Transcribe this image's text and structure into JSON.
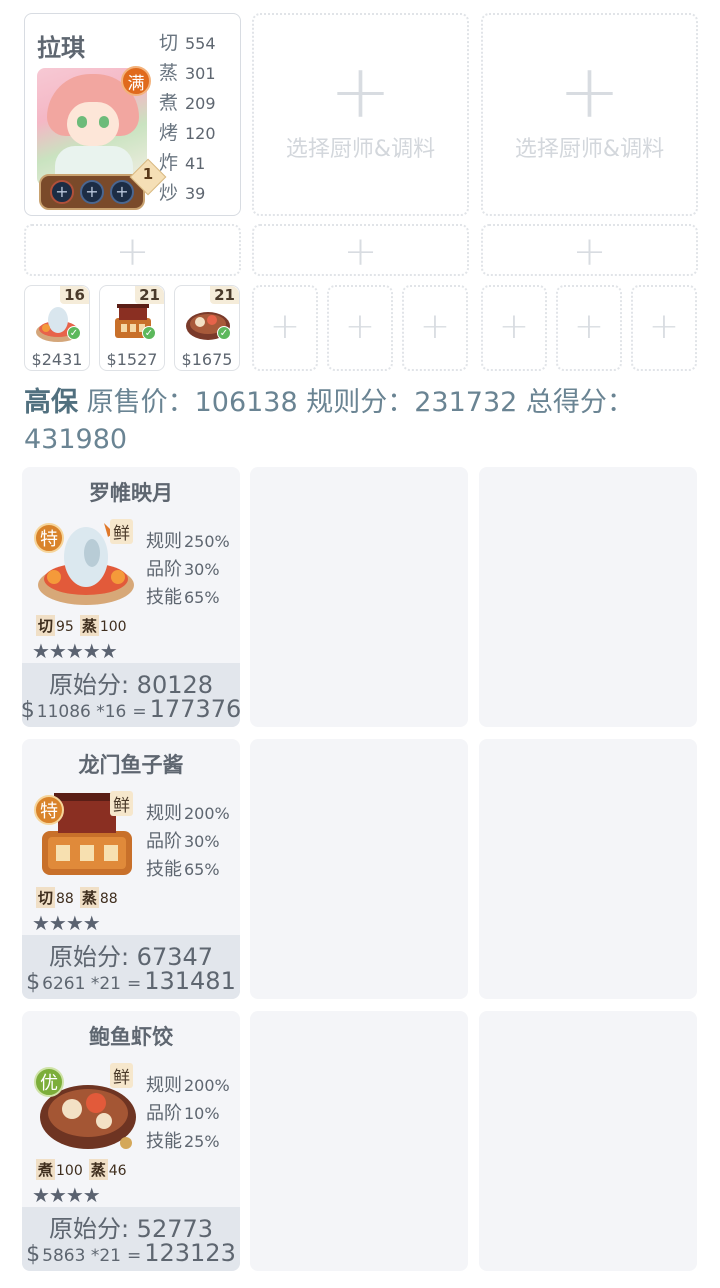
{
  "chef": {
    "name": "拉琪",
    "full_badge": "满",
    "level": "1",
    "skills": [
      {
        "name": "切",
        "value": "554"
      },
      {
        "name": "蒸",
        "value": "301"
      },
      {
        "name": "煮",
        "value": "209"
      },
      {
        "name": "烤",
        "value": "120"
      },
      {
        "name": "炸",
        "value": "41"
      },
      {
        "name": "炒",
        "value": "39"
      }
    ]
  },
  "chef_slots": [
    {
      "label": "选择厨师&调料"
    },
    {
      "label": "选择厨师&调料"
    }
  ],
  "recipe_cards": [
    {
      "count": "16",
      "price": "$2431"
    },
    {
      "count": "21",
      "price": "$1527"
    },
    {
      "count": "21",
      "price": "$1675"
    }
  ],
  "score": {
    "grade": "高保",
    "text": "原售价：106138 规则分：231732 总得分：431980"
  },
  "dishes": [
    {
      "title": "罗帷映月",
      "tier": "特",
      "tag": "鲜",
      "mods": [
        {
          "name": "规则",
          "value": "250%"
        },
        {
          "name": "品阶",
          "value": "30%"
        },
        {
          "name": "技能",
          "value": "65%"
        }
      ],
      "reqs": [
        {
          "name": "切",
          "value": "95"
        },
        {
          "name": "蒸",
          "value": "100"
        }
      ],
      "stars": "★★★★★",
      "raw_score": "原始分: 80128",
      "dollar": "$",
      "calc": "11086 *16",
      "eq": "=",
      "total": "177376"
    },
    {
      "title": "龙门鱼子酱",
      "tier": "特",
      "tag": "鲜",
      "mods": [
        {
          "name": "规则",
          "value": "200%"
        },
        {
          "name": "品阶",
          "value": "30%"
        },
        {
          "name": "技能",
          "value": "65%"
        }
      ],
      "reqs": [
        {
          "name": "切",
          "value": "88"
        },
        {
          "name": "蒸",
          "value": "88"
        }
      ],
      "stars": "★★★★",
      "raw_score": "原始分: 67347",
      "dollar": "$",
      "calc": "6261 *21",
      "eq": "=",
      "total": "131481"
    },
    {
      "title": "鲍鱼虾饺",
      "tier": "优",
      "tag": "鲜",
      "mods": [
        {
          "name": "规则",
          "value": "200%"
        },
        {
          "name": "品阶",
          "value": "10%"
        },
        {
          "name": "技能",
          "value": "25%"
        }
      ],
      "reqs": [
        {
          "name": "煮",
          "value": "100"
        },
        {
          "name": "蒸",
          "value": "46"
        }
      ],
      "stars": "★★★★",
      "raw_score": "原始分: 52773",
      "dollar": "$",
      "calc": "5863 *21",
      "eq": "=",
      "total": "123123"
    }
  ],
  "icons": {
    "plus": "+",
    "equip_plus": "+",
    "check": "✓"
  }
}
